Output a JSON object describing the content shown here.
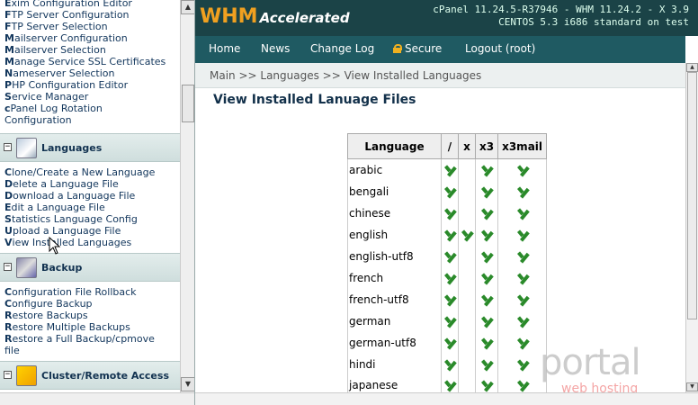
{
  "sidebar": {
    "top_links": [
      {
        "first": "E",
        "rest": "xim Configuration Editor"
      },
      {
        "first": "F",
        "rest": "TP Server Configuration"
      },
      {
        "first": "F",
        "rest": "TP Server Selection"
      },
      {
        "first": "M",
        "rest": "ailserver Configuration"
      },
      {
        "first": "M",
        "rest": "ailserver Selection"
      },
      {
        "first": "M",
        "rest": "anage Service SSL Certificates"
      },
      {
        "first": "N",
        "rest": "ameserver Selection"
      },
      {
        "first": "P",
        "rest": "HP Configuration Editor"
      },
      {
        "first": "S",
        "rest": "ervice Manager"
      },
      {
        "first": "c",
        "rest": "Panel Log Rotation"
      },
      {
        "first": "",
        "rest": "Configuration"
      }
    ],
    "sections": [
      {
        "label": "Languages",
        "toggle": "−",
        "links": [
          {
            "first": "C",
            "rest": "lone/Create a New Language"
          },
          {
            "first": "D",
            "rest": "elete a Language File"
          },
          {
            "first": "D",
            "rest": "ownload a Language File"
          },
          {
            "first": "E",
            "rest": "dit a Language File"
          },
          {
            "first": "S",
            "rest": "tatistics Language Config"
          },
          {
            "first": "U",
            "rest": "pload a Language File"
          },
          {
            "first": "V",
            "rest": "iew Installed Languages"
          }
        ]
      },
      {
        "label": "Backup",
        "toggle": "−",
        "links": [
          {
            "first": "C",
            "rest": "onfiguration File Rollback"
          },
          {
            "first": "C",
            "rest": "onfigure Backup"
          },
          {
            "first": "R",
            "rest": "estore Backups"
          },
          {
            "first": "R",
            "rest": "estore Multiple Backups"
          },
          {
            "first": "R",
            "rest": "estore a Full Backup/cpmove"
          },
          {
            "first": "",
            "rest": "file"
          }
        ]
      },
      {
        "label": "Cluster/Remote Access",
        "toggle": "−",
        "links": []
      }
    ]
  },
  "header": {
    "logo_main": "WHM",
    "logo_sub": "Accelerated",
    "version_line1": "cPanel 11.24.5-R37946 - WHM 11.24.2 - X 3.9",
    "version_line2": "CENTOS 5.3 i686 standard on test"
  },
  "nav": {
    "home": "Home",
    "news": "News",
    "changelog": "Change Log",
    "secure": "Secure",
    "logout": "Logout (root)"
  },
  "breadcrumb": "Main >> Languages >> View Installed Languages",
  "page_title": "View Installed Lanuage Files",
  "table": {
    "headers": [
      "Language",
      "/",
      "x",
      "x3",
      "x3mail"
    ],
    "rows": [
      {
        "lang": "arabic",
        "checks": [
          true,
          false,
          true,
          true
        ]
      },
      {
        "lang": "bengali",
        "checks": [
          true,
          false,
          true,
          true
        ]
      },
      {
        "lang": "chinese",
        "checks": [
          true,
          false,
          true,
          true
        ]
      },
      {
        "lang": "english",
        "checks": [
          true,
          true,
          true,
          true
        ]
      },
      {
        "lang": "english-utf8",
        "checks": [
          true,
          false,
          true,
          true
        ]
      },
      {
        "lang": "french",
        "checks": [
          true,
          false,
          true,
          true
        ]
      },
      {
        "lang": "french-utf8",
        "checks": [
          true,
          false,
          true,
          true
        ]
      },
      {
        "lang": "german",
        "checks": [
          true,
          false,
          true,
          true
        ]
      },
      {
        "lang": "german-utf8",
        "checks": [
          true,
          false,
          true,
          true
        ]
      },
      {
        "lang": "hindi",
        "checks": [
          true,
          false,
          true,
          true
        ]
      },
      {
        "lang": "japanese",
        "checks": [
          true,
          false,
          true,
          true
        ]
      }
    ]
  },
  "watermark": {
    "big": "portal",
    "small": "web hosting"
  },
  "colors": {
    "header_bg": "#1b4347",
    "nav_bg": "#1f5a62",
    "logo_orange": "#f0a020",
    "check_green": "#2a8a2a"
  },
  "icons": {
    "languages": "languages-icon",
    "backup": "backup-icon",
    "cluster": "cluster-icon",
    "secure": "lock-icon"
  }
}
